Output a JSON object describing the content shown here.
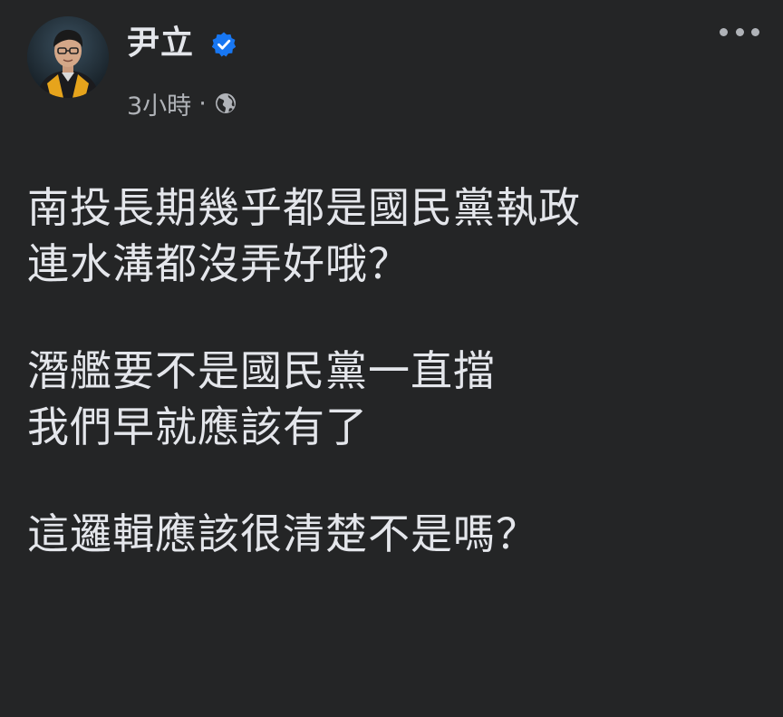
{
  "author": {
    "name": "尹立",
    "verified": true
  },
  "meta": {
    "time": "3小時",
    "separator": "·",
    "audience_icon": "globe-icon"
  },
  "menu": {
    "icon": "more-options-icon"
  },
  "post": {
    "paragraphs": [
      [
        "南投長期幾乎都是國民黨執政",
        "連水溝都沒弄好哦？"
      ],
      [
        "潛艦要不是國民黨一直擋",
        "我們早就應該有了"
      ],
      [
        "這邏輯應該很清楚不是嗎？"
      ]
    ]
  },
  "colors": {
    "background": "#242526",
    "text_primary": "#e4e6eb",
    "text_secondary": "#b0b3b8",
    "verified_blue": "#1877f2"
  }
}
